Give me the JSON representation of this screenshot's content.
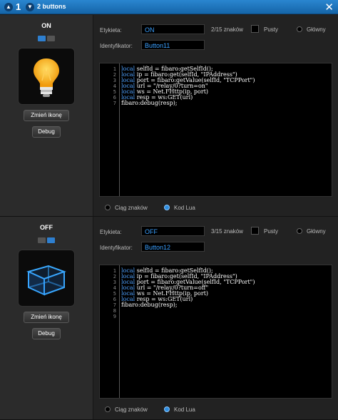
{
  "window": {
    "number": "1",
    "title": "2 buttons"
  },
  "labels": {
    "etykieta": "Etykieta:",
    "identyfikator": "Identyfikator:",
    "pusty": "Pusty",
    "glowny": "Główny",
    "change_icon": "Zmień ikonę",
    "debug": "Debug",
    "ciag": "Ciąg znaków",
    "kod_lua": "Kod Lua"
  },
  "buttons": [
    {
      "state": "ON",
      "label_value": "ON",
      "id_value": "Button11",
      "char_count": "2/15 znaków",
      "code_lines": [
        "local selfId = fibaro:getSelfId();",
        "local ip = fibaro:get(selfId, \"IPAddress\")",
        "local port = fibaro:getValue(selfId, \"TCPPort\")",
        "local url = \"/relay/0?turn=on\"",
        "local ws = Net.FHttp(ip, port)",
        "local resp = ws:GET(url)",
        "fibaro:debug(resp);"
      ],
      "line_numbers": [
        "1",
        "2",
        "3",
        "4",
        "5",
        "6",
        "7"
      ]
    },
    {
      "state": "OFF",
      "label_value": "OFF",
      "id_value": "Button12",
      "char_count": "3/15 znaków",
      "code_lines": [
        "local selfId = fibaro:getSelfId();",
        "local ip = fibaro:get(selfId, \"IPAddress\")",
        "local port = fibaro:getValue(selfId, \"TCPPort\")",
        "local url = \"/relay/0?turn=off\"",
        "local ws = Net.FHttp(ip, port)",
        "local resp = ws:GET(url)",
        "fibaro:debug(resp);",
        "",
        ""
      ],
      "line_numbers": [
        "1",
        "2",
        "3",
        "4",
        "5",
        "6",
        "7",
        "8",
        "9"
      ]
    }
  ],
  "icons": [
    "lightbulb-icon",
    "cube-icon",
    "close-icon",
    "arrow-up-icon",
    "arrow-down-icon"
  ],
  "colors": {
    "titlebar": "#1a74bd",
    "accent": "#3aa0ff",
    "toggle_active": "#2e7fcf",
    "toggle_inactive": "#555555"
  }
}
